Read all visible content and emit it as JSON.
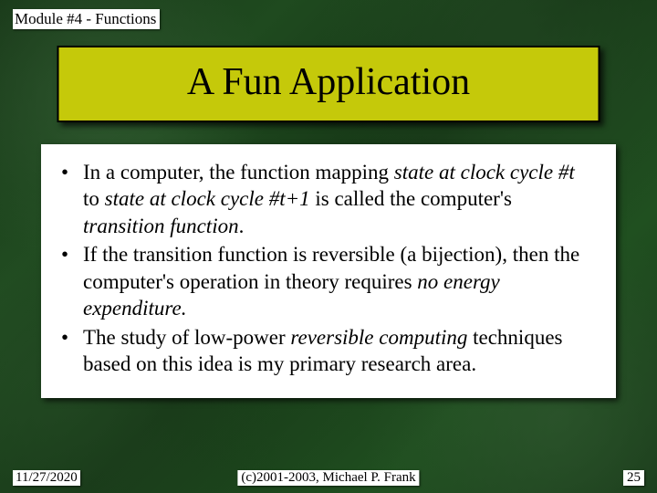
{
  "header": "Module #4 - Functions",
  "title": "A Fun Application",
  "bullets": [
    {
      "pre": "In a computer, the function mapping ",
      "i1": "state at clock cycle #t",
      "mid1": " to ",
      "i2": "state at clock cycle #t+1",
      "mid2": " is called the computer's ",
      "i3": "transition function",
      "post": "."
    },
    {
      "pre": "If the transition function is reversible (a bijection), then the computer's operation in theory requires ",
      "i1": "no energy expenditure.",
      "mid1": "",
      "i2": "",
      "mid2": "",
      "i3": "",
      "post": ""
    },
    {
      "pre": "The study of low-power ",
      "i1": "reversible computing",
      "mid1": " techniques based on this idea is my primary research area.",
      "i2": "",
      "mid2": "",
      "i3": "",
      "post": ""
    }
  ],
  "footer": {
    "date": "11/27/2020",
    "copyright": "(c)2001-2003, Michael P. Frank",
    "page": "25"
  }
}
